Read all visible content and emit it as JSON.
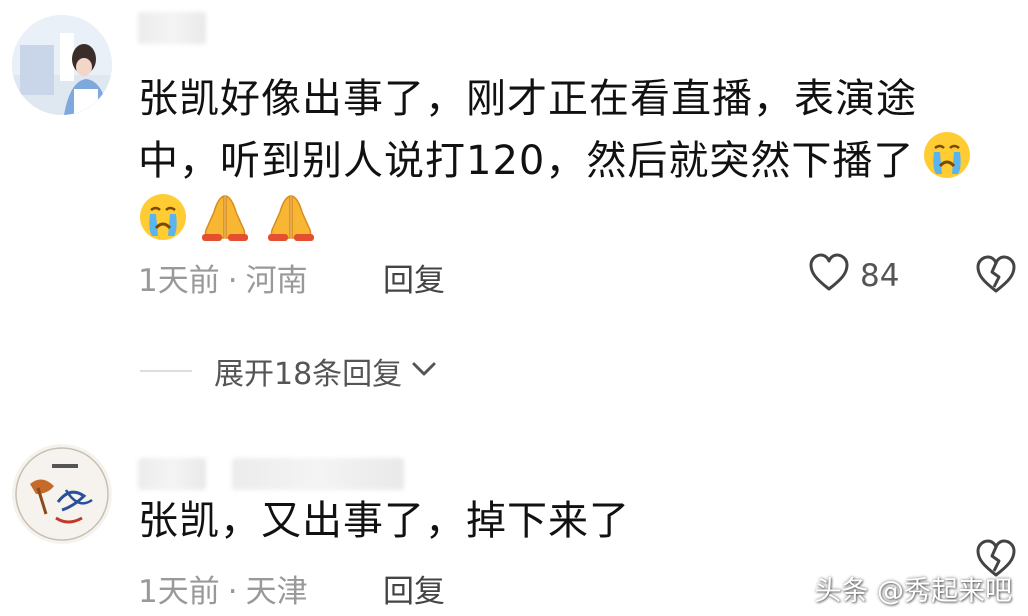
{
  "comments": [
    {
      "lines": [
        "张凯好像出事了，刚才正在看直播，表演途",
        "中，听到别人说打120，然后就突然下播了"
      ],
      "time": "1天前",
      "separator": "·",
      "location": "河南",
      "reply_label": "回复",
      "like_count": "84",
      "emojis": [
        "crying-face-emoji",
        "crying-face-emoji",
        "folded-hands-emoji",
        "folded-hands-emoji"
      ]
    },
    {
      "lines": [
        "张凯，又出事了，掉下来了"
      ],
      "time": "1天前",
      "separator": "·",
      "location": "天津",
      "reply_label": "回复"
    }
  ],
  "expand_replies": {
    "label": "展开18条回复",
    "icon": "chevron-down-icon"
  },
  "watermark": "头条 @秀起来吧",
  "colors": {
    "text": "#111111",
    "meta": "#999999",
    "background": "#ffffff"
  }
}
